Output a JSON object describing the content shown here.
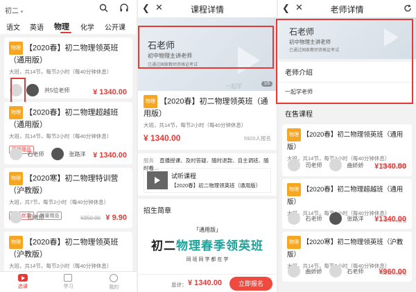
{
  "panel1": {
    "grade": "初二",
    "tabs": [
      "语文",
      "英语",
      "物理",
      "化学",
      "公开课"
    ],
    "active_tab": 2,
    "courses": [
      {
        "tag": "物理",
        "title": "【2020春】初二物理领英班（通用版）",
        "meta": "大班，共14节，每节2小时（每40分钟休息）",
        "teachers": "共5位老师",
        "price": "¥ 1340.00"
      },
      {
        "tag": "物理",
        "title": "【2020春】初二物理超越班（通用版）",
        "meta": "大班，共14节，每节2小时（每40分钟休息）",
        "badges": [
          "限量赠品"
        ],
        "t1": "石老师",
        "t2": "张路洋",
        "price": "¥ 1340.00"
      },
      {
        "tag": "物理",
        "title": "【2020寒】初二物理特训营（沪教版）",
        "meta": "大班，共7节，每节2小时（每40分钟休息）",
        "badges": [
          "超值优惠",
          "限量赠品"
        ],
        "t1": "司老师",
        "old_price": "¥350.00",
        "price": "¥ 9.90"
      },
      {
        "tag": "物理",
        "title": "【2020春】初二物理领英班（沪教版）",
        "meta": "大班，共14节，每节2小时（每40分钟休息）"
      }
    ],
    "nav": [
      {
        "label": "选课",
        "active": true
      },
      {
        "label": "学习",
        "active": false
      },
      {
        "label": "我的",
        "active": false
      }
    ]
  },
  "panel2": {
    "title": "课程详情",
    "banner": {
      "name": "石老师",
      "role": "初中物理主讲老师",
      "cert": "已通过国家教师资格证考试",
      "brand": "一起学",
      "counter": "1/5"
    },
    "course_tag": "物理",
    "course_title": "【2020春】初二物理领英班（通用版）",
    "meta": "大班，共14节，每节2小时（每40分钟休息）",
    "price": "¥ 1340.00",
    "enrolled": "5920人报名",
    "service_label": "服务",
    "service_text": "直播授课、及时答疑、随时退款、自主调班、随时看…",
    "trial_title": "试听课程",
    "trial_sub": "【2020春】初二物理领英班（通用版）",
    "intro_title": "招生简章",
    "poster": {
      "edition": "「通用版」",
      "prefix": "初二",
      "main": "物理春季领英班",
      "sub": "同 班 同 学 都 在 学"
    },
    "total_label": "总计：",
    "total": "¥ 1340.00",
    "cta": "立即报名"
  },
  "panel3": {
    "title": "老师详情",
    "banner": {
      "name": "石老师",
      "role": "初中物理主讲老师",
      "cert": "已通过国家教师资格证考试",
      "brand": "一起学"
    },
    "intro_title": "老师介绍",
    "intro_text": "一起学老师",
    "sale_title": "在售课程",
    "courses": [
      {
        "tag": "物理",
        "title": "【2020春】初二物理领英班（通用版）",
        "meta": "大班，共14节，每节2小时（每40分钟休息）",
        "count": "5920人报名",
        "t1": "司老师",
        "t2": "曲娇娇",
        "price": "¥1340.00"
      },
      {
        "tag": "物理",
        "title": "【2020春】初二物理超越班（通用版）",
        "meta": "大班，共14节，每节2小时（每40分钟休息）",
        "count": "520人报名",
        "t1": "石老师",
        "t2": "张路洋",
        "price": "¥1340.00"
      },
      {
        "tag": "物理",
        "title": "【2020寒】初二物理领英班（沪教版）",
        "meta": "大班，共14节，每节2小时（每40分钟休息）",
        "count": "6652人报名",
        "t1": "曲娇娇",
        "t2": "石老师",
        "price": "¥960.00"
      }
    ]
  },
  "colors": {
    "accent": "#e53935",
    "tag": "#f5a623",
    "teal": "#1ba39c"
  }
}
